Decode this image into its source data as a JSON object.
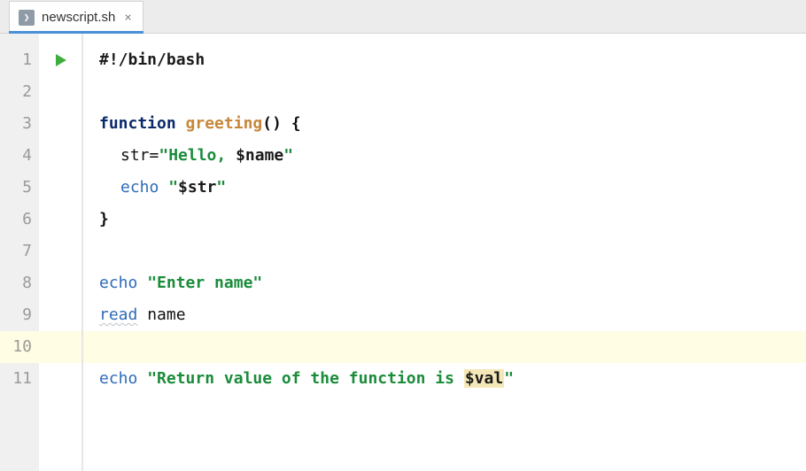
{
  "tab": {
    "filename": "newscript.sh",
    "close_glyph": "×",
    "icon_glyph": "❯"
  },
  "gutter": {
    "lines": [
      "1",
      "2",
      "3",
      "4",
      "5",
      "6",
      "7",
      "8",
      "9",
      "10",
      "11"
    ],
    "current": 10
  },
  "code": {
    "l1": {
      "shebang": "#!/bin/bash"
    },
    "l3": {
      "kw": "function",
      "sp": " ",
      "fn": "greeting",
      "after": "() {"
    },
    "l4": {
      "id": "str=",
      "str1": "\"Hello, ",
      "var": "$name",
      "str2": "\""
    },
    "l5": {
      "cmd": "echo",
      "sp": " ",
      "str1": "\"",
      "var": "$str",
      "str2": "\""
    },
    "l6": {
      "brace": "}"
    },
    "l8": {
      "cmd": "echo",
      "sp": " ",
      "str": "\"Enter name\""
    },
    "l9": {
      "cmd": "read",
      "sp": " ",
      "id": "name"
    },
    "l11": {
      "cmd": "echo",
      "sp": " ",
      "str1": "\"Return value of the function is ",
      "var": "$val",
      "str2": "\""
    }
  }
}
